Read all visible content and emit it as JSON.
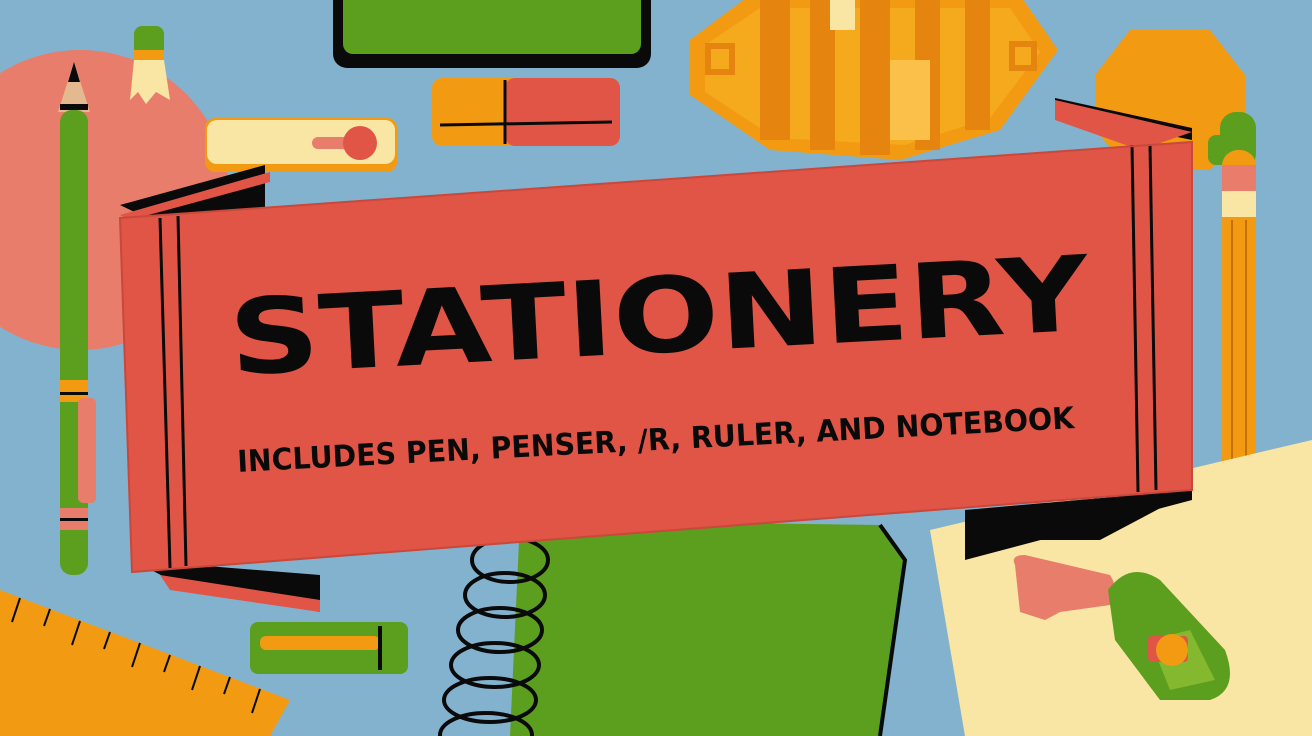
{
  "banner": {
    "title": "STATIONERY",
    "subtitle": "INCLUDES PEN, PENSER, /R, RULER, AND NOTEBOOK"
  },
  "colors": {
    "background": "#83b2cf",
    "banner_red": "#e05546",
    "green": "#5c9e1e",
    "orange": "#f29b12",
    "salmon": "#e77d6a",
    "cream": "#f9e6a4",
    "ink": "#0a0a0a"
  },
  "illustrations": [
    "pencil-icon",
    "pencil-tip-icon",
    "eraser-icon",
    "usb-drive-icon",
    "toggle-switch-icon",
    "pencil-box-icon",
    "ruler-icon",
    "spiral-notebook-icon",
    "paper-sheet-icon",
    "stapler-icon",
    "pen-cap-icon"
  ]
}
